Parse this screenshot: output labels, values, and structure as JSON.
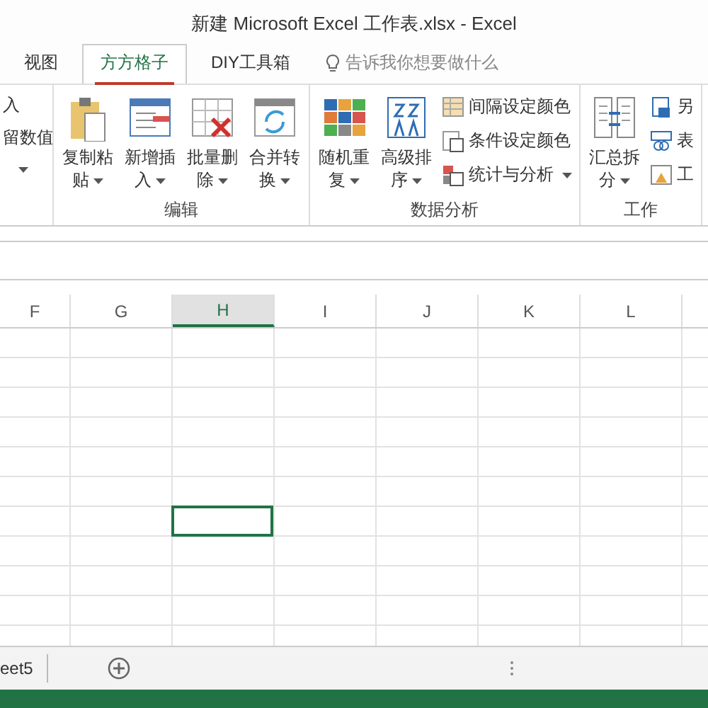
{
  "window": {
    "title": "新建 Microsoft Excel 工作表.xlsx - Excel"
  },
  "tabs": [
    {
      "label": "视图",
      "selected": false
    },
    {
      "label": "方方格子",
      "selected": true
    },
    {
      "label": "DIY工具箱",
      "selected": false
    }
  ],
  "tell_me": {
    "placeholder": "告诉我你想要做什么"
  },
  "ribbon": {
    "partial_group": {
      "lines": [
        "入",
        "留数值"
      ],
      "has_menu": true
    },
    "groups": [
      {
        "label": "编辑",
        "items": [
          {
            "kind": "large",
            "label": "复制粘贴",
            "has_menu": true
          },
          {
            "kind": "large",
            "label": "新增插入",
            "has_menu": true
          },
          {
            "kind": "large",
            "label": "批量删除",
            "has_menu": true
          },
          {
            "kind": "large",
            "label": "合并转换",
            "has_menu": true
          }
        ]
      },
      {
        "label": "数据分析",
        "items": [
          {
            "kind": "large",
            "label": "随机重复",
            "has_menu": true
          },
          {
            "kind": "large",
            "label": "高级排序",
            "has_menu": true
          },
          {
            "kind": "small",
            "label": "间隔设定颜色",
            "has_menu": false
          },
          {
            "kind": "small",
            "label": "条件设定颜色",
            "has_menu": false
          },
          {
            "kind": "small",
            "label": "统计与分析",
            "has_menu": true
          }
        ]
      },
      {
        "label": "工作",
        "items": [
          {
            "kind": "large",
            "label": "汇总拆分",
            "has_menu": true
          },
          {
            "kind": "small",
            "label": "另",
            "has_menu": false
          },
          {
            "kind": "small",
            "label": "表",
            "has_menu": false
          },
          {
            "kind": "small",
            "label": "工",
            "has_menu": false
          }
        ]
      }
    ]
  },
  "columns": [
    {
      "label": "F",
      "selected": false
    },
    {
      "label": "G",
      "selected": false
    },
    {
      "label": "H",
      "selected": true
    },
    {
      "label": "I",
      "selected": false
    },
    {
      "label": "J",
      "selected": false
    },
    {
      "label": "K",
      "selected": false
    },
    {
      "label": "L",
      "selected": false
    }
  ],
  "rows": [
    {
      "selected": false
    },
    {
      "selected": false
    },
    {
      "selected": false
    },
    {
      "selected": false
    },
    {
      "selected": false
    },
    {
      "selected": false
    },
    {
      "selected": true
    },
    {
      "selected": false
    },
    {
      "selected": false
    },
    {
      "selected": false
    }
  ],
  "sheet_tabs": [
    {
      "label": "eet5"
    }
  ]
}
